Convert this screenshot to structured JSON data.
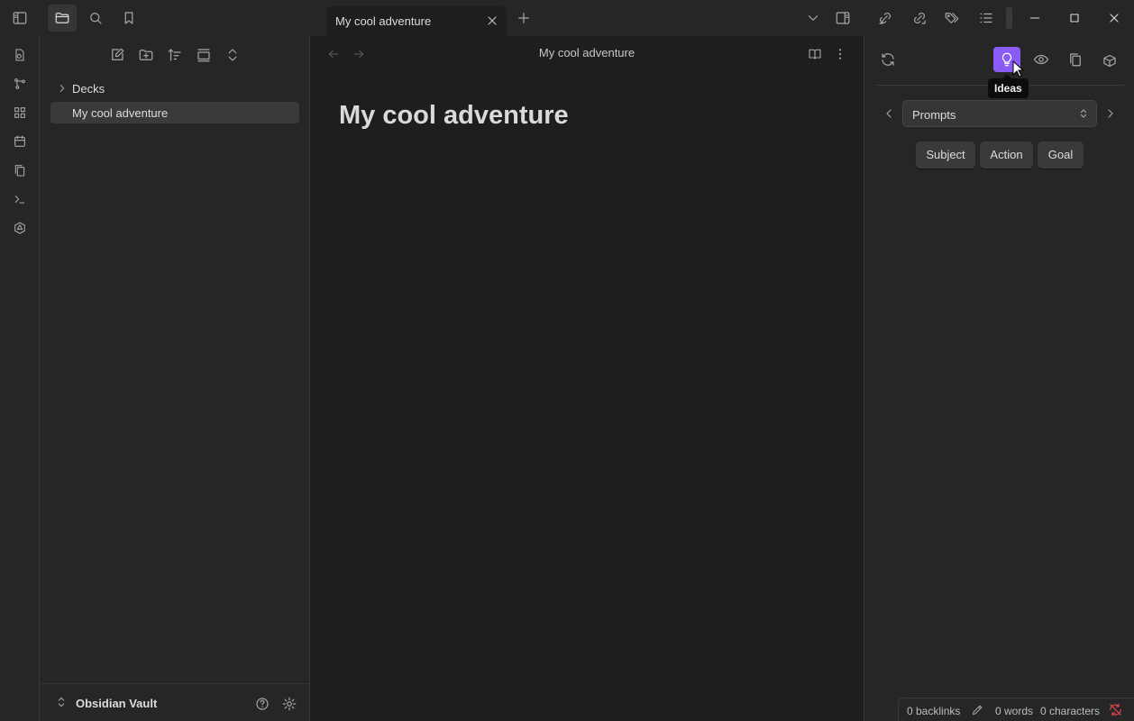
{
  "tab": {
    "title": "My cool adventure"
  },
  "explorer": {
    "items": [
      {
        "label": "Decks",
        "type": "folder"
      },
      {
        "label": "My cool adventure",
        "type": "file",
        "active": true
      }
    ],
    "vault_name": "Obsidian Vault"
  },
  "editor": {
    "view_title": "My cool adventure",
    "note_title": "My cool adventure"
  },
  "rightpanel": {
    "tooltip": "Ideas",
    "select_value": "Prompts",
    "chips": [
      "Subject",
      "Action",
      "Goal"
    ]
  },
  "status": {
    "backlinks": "0 backlinks",
    "words": "0 words",
    "characters": "0 characters"
  },
  "colors": {
    "accent": "#8a5cf5",
    "sync_error": "#e5484d"
  }
}
